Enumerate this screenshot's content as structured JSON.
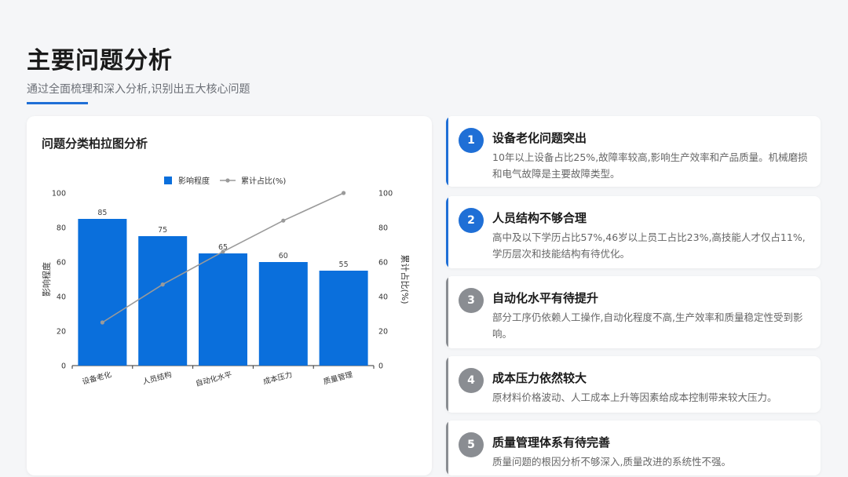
{
  "page": {
    "title": "主要问题分析",
    "subtitle": "通过全面梳理和深入分析,识别出五大核心问题",
    "accent_color": "#1f6fd6",
    "muted_color": "#8a8d92"
  },
  "chart_card": {
    "title": "问题分类柏拉图分析"
  },
  "chart_data": {
    "type": "bar",
    "categories": [
      "设备老化",
      "人员结构",
      "自动化水平",
      "成本压力",
      "质量管理"
    ],
    "series": [
      {
        "name": "影响程度",
        "type": "bar",
        "values": [
          85,
          75,
          65,
          60,
          55
        ],
        "color": "#0a6fdc"
      },
      {
        "name": "累计占比(%)",
        "type": "line",
        "values": [
          25,
          47,
          66,
          84,
          100
        ],
        "color": "#9a9a9a"
      }
    ],
    "ylabel": "影响程度",
    "ylabel_right": "累计占比(%)",
    "ylim": [
      0,
      100
    ],
    "ylim_right": [
      0,
      100
    ],
    "yticks": [
      0,
      20,
      40,
      60,
      80,
      100
    ],
    "yticks_right": [
      0,
      20,
      40,
      60,
      80,
      100
    ],
    "legend": "top-center",
    "grid": false
  },
  "issues": [
    {
      "number": "1",
      "title": "设备老化问题突出",
      "desc": "10年以上设备占比25%,故障率较高,影响生产效率和产品质量。机械磨损和电气故障是主要故障类型。",
      "highlight": true
    },
    {
      "number": "2",
      "title": "人员结构不够合理",
      "desc": "高中及以下学历占比57%,46岁以上员工占比23%,高技能人才仅占11%,学历层次和技能结构有待优化。",
      "highlight": true
    },
    {
      "number": "3",
      "title": "自动化水平有待提升",
      "desc": "部分工序仍依赖人工操作,自动化程度不高,生产效率和质量稳定性受到影响。",
      "highlight": false
    },
    {
      "number": "4",
      "title": "成本压力依然较大",
      "desc": "原材料价格波动、人工成本上升等因素给成本控制带来较大压力。",
      "highlight": false
    },
    {
      "number": "5",
      "title": "质量管理体系有待完善",
      "desc": "质量问题的根因分析不够深入,质量改进的系统性不强。",
      "highlight": false
    }
  ]
}
